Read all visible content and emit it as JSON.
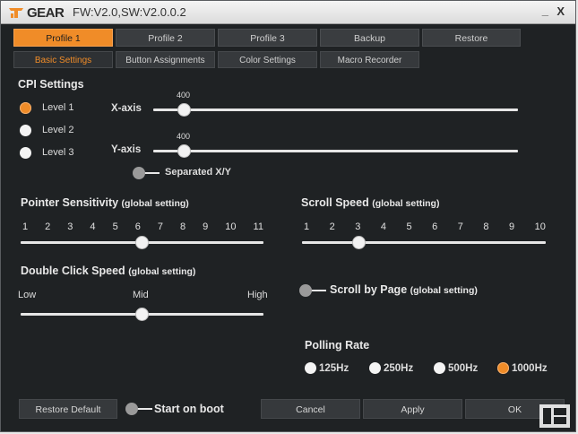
{
  "titlebar": {
    "logo_text": "GEAR",
    "version": "FW:V2.0,SW:V2.0.0.2",
    "minimize": "_",
    "close": "X"
  },
  "profile_tabs": [
    {
      "label": "Profile 1",
      "active": true
    },
    {
      "label": "Profile 2",
      "active": false
    },
    {
      "label": "Profile 3",
      "active": false
    },
    {
      "label": "Backup",
      "active": false
    },
    {
      "label": "Restore",
      "active": false
    }
  ],
  "sub_tabs": [
    {
      "label": "Basic Settings",
      "active": true
    },
    {
      "label": "Button Assignments",
      "active": false
    },
    {
      "label": "Color Settings",
      "active": false
    },
    {
      "label": "Macro Recorder",
      "active": false
    }
  ],
  "cpi": {
    "title": "CPI Settings",
    "levels": [
      {
        "label": "Level 1",
        "selected": true
      },
      {
        "label": "Level 2",
        "selected": false
      },
      {
        "label": "Level 3",
        "selected": false
      }
    ],
    "x_axis": {
      "label": "X-axis",
      "value": "400",
      "fraction": 0.085
    },
    "y_axis": {
      "label": "Y-axis",
      "value": "400",
      "fraction": 0.085
    },
    "separated_label": "Separated X/Y",
    "separated_on": false
  },
  "pointer": {
    "title": "Pointer Sensitivity",
    "note": "(global setting)",
    "ticks": [
      "1",
      "2",
      "3",
      "4",
      "5",
      "6",
      "7",
      "8",
      "9",
      "10",
      "11"
    ],
    "value": 6
  },
  "scroll": {
    "title": "Scroll Speed",
    "note": "(global setting)",
    "ticks": [
      "1",
      "2",
      "3",
      "4",
      "5",
      "6",
      "7",
      "8",
      "9",
      "10"
    ],
    "value": 3
  },
  "double_click": {
    "title": "Double Click Speed",
    "note": "(global setting)",
    "low": "Low",
    "mid": "Mid",
    "high": "High",
    "fraction": 0.5
  },
  "scroll_by_page": {
    "title": "Scroll by Page",
    "note": "(global setting)",
    "on": false
  },
  "polling": {
    "title": "Polling Rate",
    "options": [
      {
        "label": "125Hz",
        "selected": false
      },
      {
        "label": "250Hz",
        "selected": false
      },
      {
        "label": "500Hz",
        "selected": false
      },
      {
        "label": "1000Hz",
        "selected": true
      }
    ]
  },
  "footer": {
    "restore_default": "Restore Default",
    "start_on_boot": "Start on boot",
    "start_on_boot_on": false,
    "cancel": "Cancel",
    "apply": "Apply",
    "ok": "OK"
  },
  "colors": {
    "accent": "#f08c28",
    "background": "#1f2224",
    "button": "#36393c"
  }
}
